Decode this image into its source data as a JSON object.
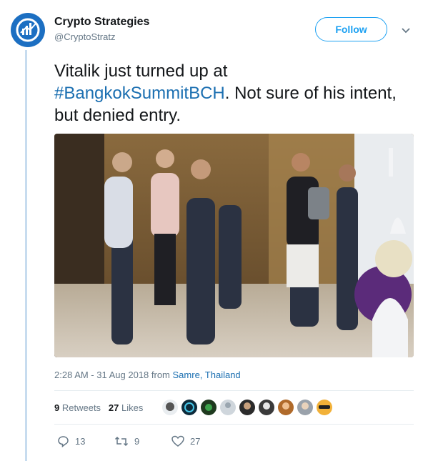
{
  "account": {
    "name": "Crypto Strategies",
    "handle": "@CryptoStratz",
    "follow_label": "Follow"
  },
  "tweet": {
    "text_before": "Vitalik just turned up at",
    "hashtag": "#BangkokSummitBCH",
    "text_after": ". Not sure of his intent, but denied entry."
  },
  "meta": {
    "timestamp": "2:28 AM - 31 Aug 2018 from",
    "place": "Samre, Thailand"
  },
  "stats": {
    "retweets_count": "9",
    "retweets_label": "Retweets",
    "likes_count": "27",
    "likes_label": "Likes"
  },
  "actions": {
    "reply_count": "13",
    "retweet_count": "9",
    "like_count": "27"
  },
  "colors": {
    "accent": "#1da1f2",
    "link": "#1b6fb1",
    "muted": "#657786"
  }
}
